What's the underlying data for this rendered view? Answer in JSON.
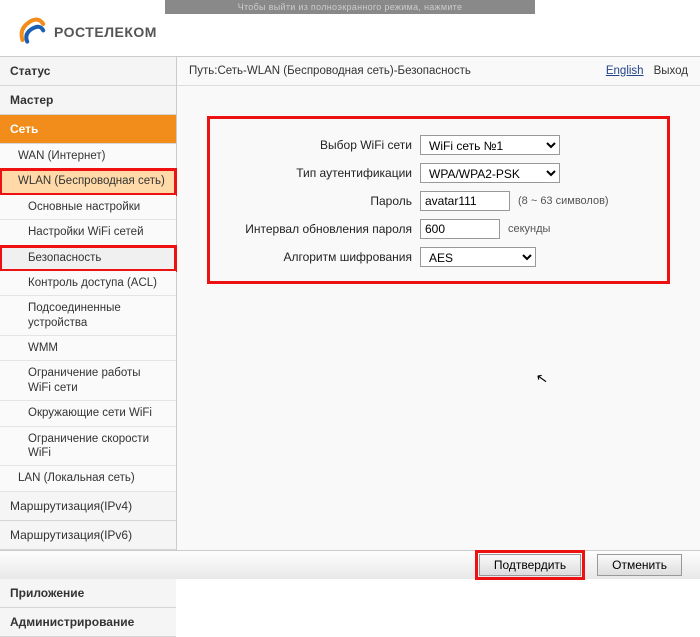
{
  "brand": "РОСТЕЛЕКОМ",
  "top_hint": "Чтобы выйти из полноэкранного режима, нажмите",
  "path": "Путь:Сеть-WLAN (Беспроводная сеть)-Безопасность",
  "lang_link": "English",
  "logout": "Выход",
  "sidebar": {
    "status": "Статус",
    "wizard": "Мастер",
    "network": "Сеть",
    "wan": "WAN (Интернет)",
    "wlan": "WLAN (Беспроводная сеть)",
    "basic": "Основные настройки",
    "wifi_profiles": "Настройки WiFi сетей",
    "security": "Безопасность",
    "acl": "Контроль доступа (ACL)",
    "connected": "Подсоединенные устройства",
    "wmm": "WMM",
    "limit": "Ограничение работы WiFi сети",
    "neighbor": "Окружающие сети WiFi",
    "speed": "Ограничение скорости WiFi",
    "lan": "LAN (Локальная сеть)",
    "route4": "Маршрутизация(IPv4)",
    "route6": "Маршрутизация(IPv6)",
    "sec_main": "Безопасность",
    "app": "Приложение",
    "admin": "Администрирование"
  },
  "form": {
    "ssid_label": "Выбор WiFi сети",
    "ssid_value": "WiFi сеть №1",
    "auth_label": "Тип аутентификации",
    "auth_value": "WPA/WPA2-PSK",
    "pw_label": "Пароль",
    "pw_value": "avatar111",
    "pw_hint": "(8 ~ 63 символов)",
    "interval_label": "Интервал обновления пароля",
    "interval_value": "600",
    "interval_unit": "секунды",
    "alg_label": "Алгоритм шифрования",
    "alg_value": "AES"
  },
  "footer": {
    "confirm": "Подтвердить",
    "cancel": "Отменить"
  }
}
